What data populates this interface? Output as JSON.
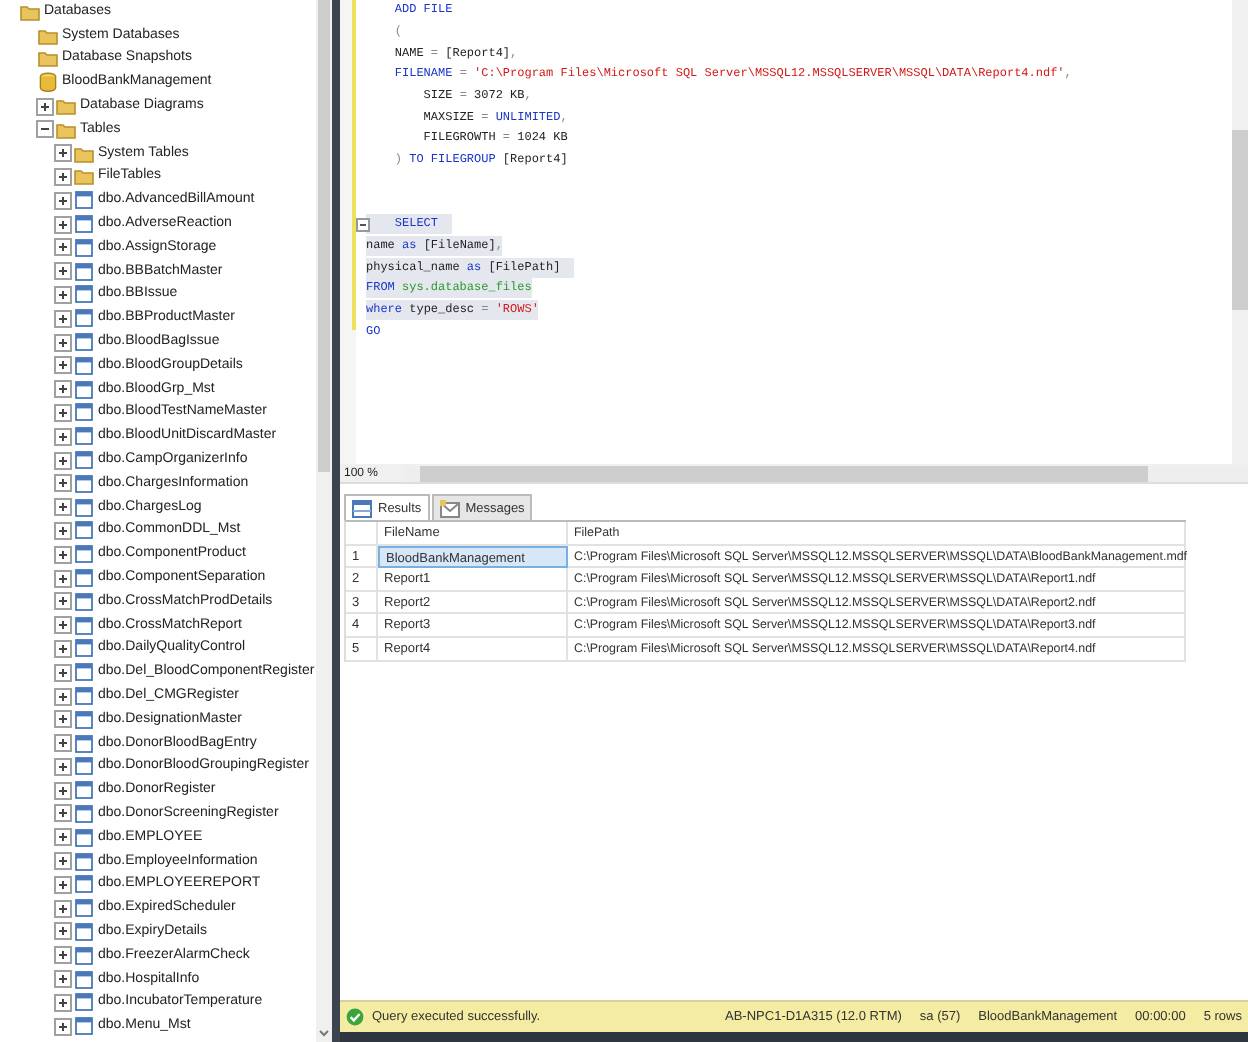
{
  "object_explorer": {
    "tree": [
      {
        "label": "Databases",
        "kind": "folder",
        "children": [
          {
            "label": "System Databases",
            "kind": "folder"
          },
          {
            "label": "Database Snapshots",
            "kind": "folder"
          },
          {
            "label": "BloodBankManagement",
            "kind": "database",
            "children": [
              {
                "label": "Database Diagrams",
                "kind": "folder",
                "expanded": false
              },
              {
                "label": "Tables",
                "kind": "folder",
                "expanded": true,
                "children": [
                  {
                    "label": "System Tables",
                    "kind": "folder",
                    "expanded": false
                  },
                  {
                    "label": "FileTables",
                    "kind": "folder",
                    "expanded": false
                  },
                  {
                    "label": "dbo.AdvancedBillAmount",
                    "kind": "table",
                    "expanded": false
                  },
                  {
                    "label": "dbo.AdverseReaction",
                    "kind": "table",
                    "expanded": false
                  },
                  {
                    "label": "dbo.AssignStorage",
                    "kind": "table",
                    "expanded": false
                  },
                  {
                    "label": "dbo.BBBatchMaster",
                    "kind": "table",
                    "expanded": false
                  },
                  {
                    "label": "dbo.BBIssue",
                    "kind": "table",
                    "expanded": false
                  },
                  {
                    "label": "dbo.BBProductMaster",
                    "kind": "table",
                    "expanded": false
                  },
                  {
                    "label": "dbo.BloodBagIssue",
                    "kind": "table",
                    "expanded": false
                  },
                  {
                    "label": "dbo.BloodGroupDetails",
                    "kind": "table",
                    "expanded": false
                  },
                  {
                    "label": "dbo.BloodGrp_Mst",
                    "kind": "table",
                    "expanded": false
                  },
                  {
                    "label": "dbo.BloodTestNameMaster",
                    "kind": "table",
                    "expanded": false
                  },
                  {
                    "label": "dbo.BloodUnitDiscardMaster",
                    "kind": "table",
                    "expanded": false
                  },
                  {
                    "label": "dbo.CampOrganizerInfo",
                    "kind": "table",
                    "expanded": false
                  },
                  {
                    "label": "dbo.ChargesInformation",
                    "kind": "table",
                    "expanded": false
                  },
                  {
                    "label": "dbo.ChargesLog",
                    "kind": "table",
                    "expanded": false
                  },
                  {
                    "label": "dbo.CommonDDL_Mst",
                    "kind": "table",
                    "expanded": false
                  },
                  {
                    "label": "dbo.ComponentProduct",
                    "kind": "table",
                    "expanded": false
                  },
                  {
                    "label": "dbo.ComponentSeparation",
                    "kind": "table",
                    "expanded": false
                  },
                  {
                    "label": "dbo.CrossMatchProdDetails",
                    "kind": "table",
                    "expanded": false
                  },
                  {
                    "label": "dbo.CrossMatchReport",
                    "kind": "table",
                    "expanded": false
                  },
                  {
                    "label": "dbo.DailyQualityControl",
                    "kind": "table",
                    "expanded": false
                  },
                  {
                    "label": "dbo.Del_BloodComponentRegister",
                    "kind": "table",
                    "expanded": false
                  },
                  {
                    "label": "dbo.Del_CMGRegister",
                    "kind": "table",
                    "expanded": false
                  },
                  {
                    "label": "dbo.DesignationMaster",
                    "kind": "table",
                    "expanded": false
                  },
                  {
                    "label": "dbo.DonorBloodBagEntry",
                    "kind": "table",
                    "expanded": false
                  },
                  {
                    "label": "dbo.DonorBloodGroupingRegister",
                    "kind": "table",
                    "expanded": false
                  },
                  {
                    "label": "dbo.DonorRegister",
                    "kind": "table",
                    "expanded": false
                  },
                  {
                    "label": "dbo.DonorScreeningRegister",
                    "kind": "table",
                    "expanded": false
                  },
                  {
                    "label": "dbo.EMPLOYEE",
                    "kind": "table",
                    "expanded": false
                  },
                  {
                    "label": "dbo.EmployeeInformation",
                    "kind": "table",
                    "expanded": false
                  },
                  {
                    "label": "dbo.EMPLOYEEREPORT",
                    "kind": "table",
                    "expanded": false
                  },
                  {
                    "label": "dbo.ExpiredScheduler",
                    "kind": "table",
                    "expanded": false
                  },
                  {
                    "label": "dbo.ExpiryDetails",
                    "kind": "table",
                    "expanded": false
                  },
                  {
                    "label": "dbo.FreezerAlarmCheck",
                    "kind": "table",
                    "expanded": false
                  },
                  {
                    "label": "dbo.HospitalInfo",
                    "kind": "table",
                    "expanded": false
                  },
                  {
                    "label": "dbo.IncubatorTemperature",
                    "kind": "table",
                    "expanded": false
                  },
                  {
                    "label": "dbo.Menu_Mst",
                    "kind": "table",
                    "expanded": false
                  }
                ]
              }
            ]
          }
        ]
      }
    ]
  },
  "editor": {
    "lines": [
      {
        "kind": "code",
        "highlighted": false,
        "tokens": [
          {
            "kind": "keyword",
            "text": "    ADD FILE"
          }
        ]
      },
      {
        "kind": "code",
        "highlighted": false,
        "tokens": [
          {
            "kind": "op",
            "text": "    ("
          }
        ]
      },
      {
        "kind": "code",
        "highlighted": false,
        "tokens": [
          {
            "kind": "plain",
            "text": "    NAME "
          },
          {
            "kind": "op",
            "text": "="
          },
          {
            "kind": "plain",
            "text": " [Report4]"
          },
          {
            "kind": "op",
            "text": ","
          }
        ]
      },
      {
        "kind": "code",
        "highlighted": false,
        "tokens": [
          {
            "kind": "keyword",
            "text": "    FILENAME "
          },
          {
            "kind": "op",
            "text": "="
          },
          {
            "kind": "string",
            "text": " 'C:\\Program Files\\Microsoft SQL Server\\MSSQL12.MSSQLSERVER\\MSSQL\\DATA\\Report4.ndf'"
          },
          {
            "kind": "op",
            "text": ","
          }
        ]
      },
      {
        "kind": "code",
        "highlighted": false,
        "tokens": [
          {
            "kind": "plain",
            "text": "        SIZE "
          },
          {
            "kind": "op",
            "text": "="
          },
          {
            "kind": "plain",
            "text": " 3072 KB"
          },
          {
            "kind": "op",
            "text": ","
          }
        ]
      },
      {
        "kind": "code",
        "highlighted": false,
        "tokens": [
          {
            "kind": "plain",
            "text": "        MAXSIZE "
          },
          {
            "kind": "op",
            "text": "="
          },
          {
            "kind": "keyword",
            "text": " UNLIMITED"
          },
          {
            "kind": "op",
            "text": ","
          }
        ]
      },
      {
        "kind": "code",
        "highlighted": false,
        "tokens": [
          {
            "kind": "plain",
            "text": "        FILEGROWTH "
          },
          {
            "kind": "op",
            "text": "="
          },
          {
            "kind": "plain",
            "text": " 1024 KB"
          }
        ]
      },
      {
        "kind": "code",
        "highlighted": false,
        "tokens": [
          {
            "kind": "op",
            "text": "    )"
          },
          {
            "kind": "keyword",
            "text": " TO FILEGROUP"
          },
          {
            "kind": "plain",
            "text": " [Report4]"
          }
        ]
      },
      {
        "kind": "blank"
      },
      {
        "kind": "blank"
      },
      {
        "kind": "code",
        "highlighted": true,
        "collapsible": true,
        "tokens": [
          {
            "kind": "keyword",
            "text": "    SELECT  "
          }
        ]
      },
      {
        "kind": "code",
        "highlighted": true,
        "tokens": [
          {
            "kind": "plain",
            "text": "name "
          },
          {
            "kind": "keyword",
            "text": "as"
          },
          {
            "kind": "plain",
            "text": " [FileName]"
          },
          {
            "kind": "op",
            "text": ","
          }
        ]
      },
      {
        "kind": "code",
        "highlighted": true,
        "tokens": [
          {
            "kind": "plain",
            "text": "physical_name "
          },
          {
            "kind": "keyword",
            "text": "as"
          },
          {
            "kind": "plain",
            "text": " [FilePath]  "
          }
        ]
      },
      {
        "kind": "code",
        "highlighted": true,
        "tokens": [
          {
            "kind": "keyword",
            "text": "FROM"
          },
          {
            "kind": "system",
            "text": " sys.database_files"
          }
        ]
      },
      {
        "kind": "code",
        "highlighted": true,
        "tokens": [
          {
            "kind": "keyword",
            "text": "where"
          },
          {
            "kind": "plain",
            "text": " type_desc "
          },
          {
            "kind": "op",
            "text": "="
          },
          {
            "kind": "string",
            "text": " 'ROWS'"
          }
        ]
      },
      {
        "kind": "code",
        "highlighted": false,
        "tokens": [
          {
            "kind": "keyword",
            "text": "GO"
          }
        ]
      }
    ]
  },
  "zoom": {
    "value": "100 %"
  },
  "results": {
    "tabs": [
      {
        "label": "Results",
        "kind": "grid",
        "selected": true
      },
      {
        "label": "Messages",
        "kind": "messages",
        "selected": false
      }
    ],
    "columns": [
      "FileName",
      "FilePath"
    ],
    "rows": [
      {
        "number": "1",
        "file_name": "BloodBankManagement",
        "file_path": "C:\\Program Files\\Microsoft SQL Server\\MSSQL12.MSSQLSERVER\\MSSQL\\DATA\\BloodBankManagement.mdf",
        "selected": true
      },
      {
        "number": "2",
        "file_name": "Report1",
        "file_path": "C:\\Program Files\\Microsoft SQL Server\\MSSQL12.MSSQLSERVER\\MSSQL\\DATA\\Report1.ndf",
        "selected": false
      },
      {
        "number": "3",
        "file_name": "Report2",
        "file_path": "C:\\Program Files\\Microsoft SQL Server\\MSSQL12.MSSQLSERVER\\MSSQL\\DATA\\Report2.ndf",
        "selected": false
      },
      {
        "number": "4",
        "file_name": "Report3",
        "file_path": "C:\\Program Files\\Microsoft SQL Server\\MSSQL12.MSSQLSERVER\\MSSQL\\DATA\\Report3.ndf",
        "selected": false
      },
      {
        "number": "5",
        "file_name": "Report4",
        "file_path": "C:\\Program Files\\Microsoft SQL Server\\MSSQL12.MSSQLSERVER\\MSSQL\\DATA\\Report4.ndf",
        "selected": false
      }
    ]
  },
  "status_bar": {
    "message": "Query executed successfully.",
    "server": "AB-NPC1-D1A315 (12.0 RTM)",
    "user": "sa (57)",
    "database": "BloodBankManagement",
    "elapsed": "00:00:00",
    "row_count": "5 rows"
  }
}
